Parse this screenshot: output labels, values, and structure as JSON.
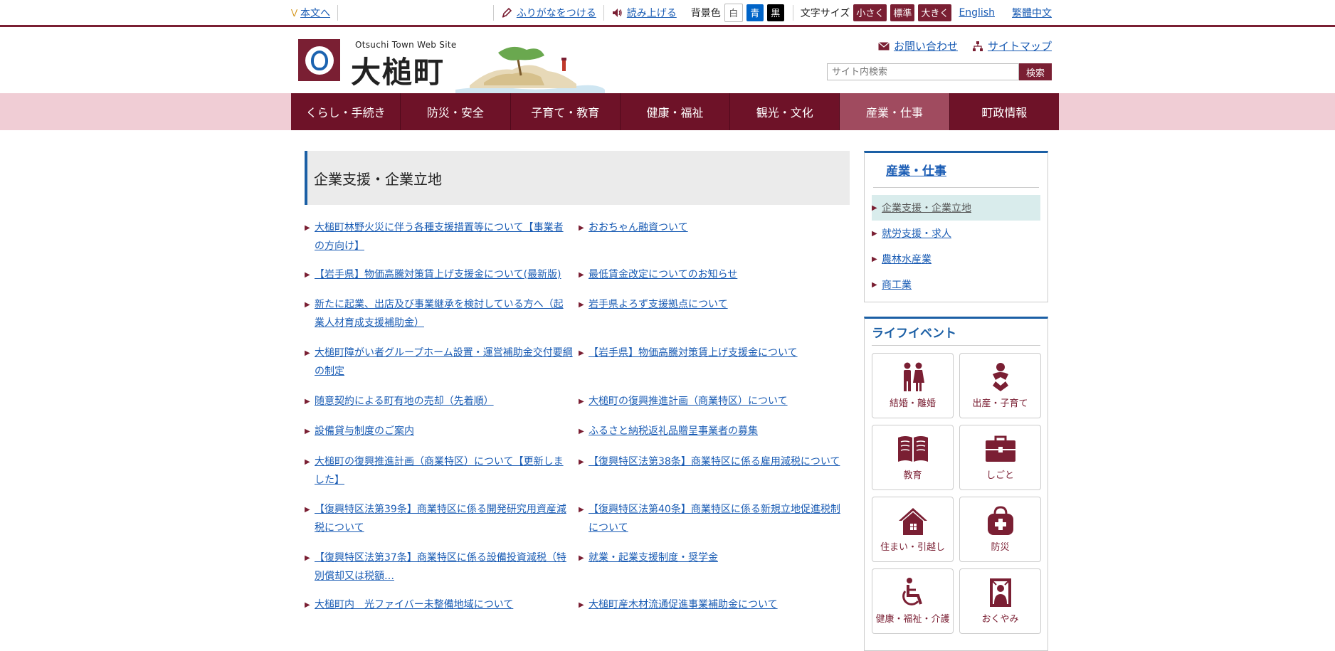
{
  "topbar": {
    "skip_label": "本文へ",
    "furigana_label": "ふりがなをつける",
    "readaloud_label": "読み上げる",
    "bg_label": "背景色",
    "bg_white": "白",
    "bg_blue": "青",
    "bg_black": "黒",
    "fontsize_label": "文字サイズ",
    "fs_small": "小さく",
    "fs_normal": "標準",
    "fs_large": "大きく",
    "lang_en": "English",
    "lang_zh": "繁體中文"
  },
  "header": {
    "site_sub": "Otsuchi Town Web Site",
    "site_name": "大槌町",
    "contact_label": "お問い合わせ",
    "sitemap_label": "サイトマップ",
    "search_placeholder": "サイト内検索",
    "search_button": "検索"
  },
  "gnav": {
    "items": [
      {
        "label": "くらし・手続き"
      },
      {
        "label": "防災・安全"
      },
      {
        "label": "子育て・教育"
      },
      {
        "label": "健康・福祉"
      },
      {
        "label": "観光・文化"
      },
      {
        "label": "産業・仕事"
      },
      {
        "label": "町政情報"
      }
    ],
    "active_index": 5
  },
  "main": {
    "title": "企業支援・企業立地",
    "links": [
      "大槌町林野火災に伴う各種支援措置等について【事業者の方向け】",
      "おおちゃん融資ついて",
      "【岩手県】物価高騰対策賃上げ支援金について(最新版)",
      "最低賃金改定についてのお知らせ",
      "新たに起業、出店及び事業継承を検討している方へ（起業人材育成支援補助金）",
      "岩手県よろず支援拠点について",
      "大槌町障がい者グループホーム設置・運営補助金交付要綱の制定",
      "【岩手県】物価高騰対策賃上げ支援金について",
      "随意契約による町有地の売却（先着順）",
      "大槌町の復興推進計画（商業特区）について",
      "設備貸与制度のご案内",
      "ふるさと納税返礼品贈呈事業者の募集",
      "大槌町の復興推進計画（商業特区）について【更新しました】",
      "【復興特区法第38条】商業特区に係る雇用減税について",
      "【復興特区法第39条】商業特区に係る開発研究用資産減税について",
      "【復興特区法第40条】商業特区に係る新規立地促進税制について",
      "【復興特区法第37条】商業特区に係る設備投資減税（特別償却又は税額…",
      "就業・起業支援制度・奨学金",
      "大槌町内　光ファイバー未整備地域について",
      "大槌町産木材流通促進事業補助金について"
    ]
  },
  "sidebar": {
    "section_title": "産業・仕事",
    "items": [
      {
        "label": "企業支援・企業立地"
      },
      {
        "label": "就労支援・求人"
      },
      {
        "label": "農林水産業"
      },
      {
        "label": "商工業"
      }
    ],
    "life_title": "ライフイベント",
    "life_items": [
      {
        "label": "結婚・離婚",
        "icon": "couple-icon"
      },
      {
        "label": "出産・子育て",
        "icon": "baby-icon"
      },
      {
        "label": "教育",
        "icon": "book-icon"
      },
      {
        "label": "しごと",
        "icon": "briefcase-icon"
      },
      {
        "label": "住まい・引越し",
        "icon": "house-icon"
      },
      {
        "label": "防災",
        "icon": "emergency-bag-icon"
      },
      {
        "label": "健康・福祉・介護",
        "icon": "wheelchair-icon"
      },
      {
        "label": "おくやみ",
        "icon": "memorial-icon"
      }
    ]
  },
  "colors": {
    "brand": "#7a1f33",
    "nav_bg": "#6e1228",
    "nav_active": "#a04b5f",
    "nav_band": "#f0cdd5",
    "link": "#1a5cb4",
    "accent_blue": "#1b5fa5"
  }
}
